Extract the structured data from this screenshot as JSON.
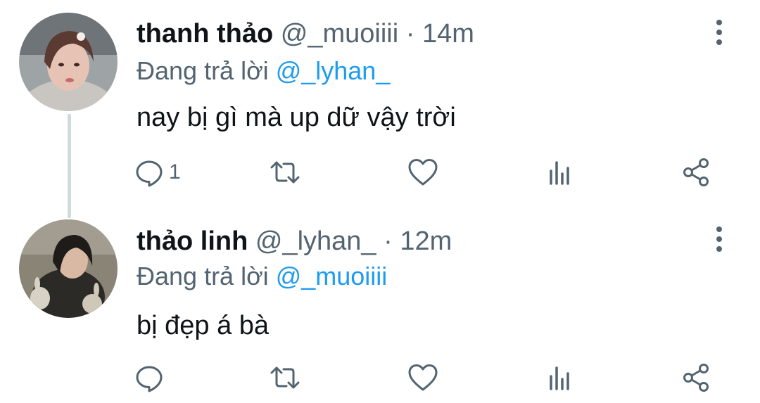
{
  "tweets": [
    {
      "display_name": "thanh thảo",
      "handle": "@_muoiiii",
      "separator": "·",
      "time": "14m",
      "reply_prefix": "Đang trả lời",
      "reply_to": "@_lyhan_",
      "text": "nay bị gì mà up dữ vậy trời",
      "reply_count": "1",
      "retweet_count": "",
      "like_count": ""
    },
    {
      "display_name": "thảo linh",
      "handle": "@_lyhan_",
      "separator": "·",
      "time": "12m",
      "reply_prefix": "Đang trả lời",
      "reply_to": "@_muoiiii",
      "text": "bị đẹp á bà",
      "reply_count": "",
      "retweet_count": "",
      "like_count": ""
    }
  ],
  "colors": {
    "text_primary": "#0f1419",
    "text_secondary": "#536471",
    "link": "#1d9bf0",
    "thread_line": "#cfd9de"
  },
  "icons": [
    "reply-icon",
    "retweet-icon",
    "like-icon",
    "views-icon",
    "share-icon",
    "more-icon"
  ]
}
